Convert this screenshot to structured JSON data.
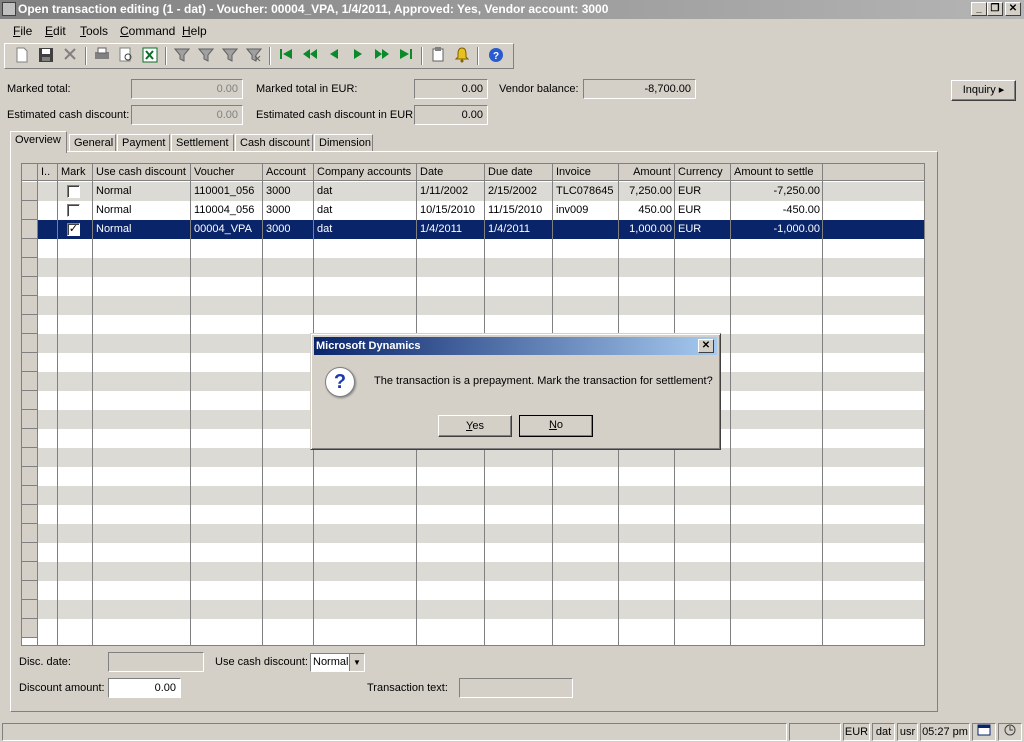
{
  "window": {
    "title": "Open transaction editing (1 - dat) - Voucher: 00004_VPA, 1/4/2011, Approved: Yes, Vendor account: 3000",
    "minimize": "_",
    "restore": "❐",
    "close": "✕"
  },
  "menu": [
    "File",
    "Edit",
    "Tools",
    "Command",
    "Help"
  ],
  "toolbar": {
    "icons": [
      "new-icon",
      "save-icon",
      "delete-icon",
      "print-icon",
      "print-preview-icon",
      "excel-icon",
      "filter-icon",
      "filter-by-selection-icon",
      "advanced-filter-icon",
      "remove-filter-icon",
      "first-record-icon",
      "previous-page-icon",
      "previous-record-icon",
      "next-record-icon",
      "next-page-icon",
      "last-record-icon",
      "document-handling-icon",
      "alert-icon",
      "help-icon"
    ]
  },
  "summary": {
    "marked_total_label": "Marked total:",
    "marked_total_value": "0.00",
    "est_cash_disc_label": "Estimated cash discount:",
    "est_cash_disc_value": "0.00",
    "marked_total_eur_label": "Marked total in EUR:",
    "marked_total_eur_value": "0.00",
    "est_cash_disc_eur_label": "Estimated cash discount in EUR:",
    "est_cash_disc_eur_value": "0.00",
    "vendor_balance_label": "Vendor balance:",
    "vendor_balance_value": "-8,700.00",
    "inquiry_label": "Inquiry"
  },
  "tabs": [
    "Overview",
    "General",
    "Payment",
    "Settlement",
    "Cash discount",
    "Dimension"
  ],
  "grid": {
    "columns": [
      "I..",
      "Mark",
      "Use cash discount",
      "Voucher",
      "Account",
      "Company accounts",
      "Date",
      "Due date",
      "Invoice",
      "Amount",
      "Currency",
      "Amount to settle"
    ],
    "rows": [
      {
        "mark": false,
        "use_cash_discount": "Normal",
        "voucher": "110001_056",
        "account": "3000",
        "company": "dat",
        "date": "1/11/2002",
        "due_date": "2/15/2002",
        "invoice": "TLC078645",
        "amount": "7,250.00",
        "currency": "EUR",
        "amount_to_settle": "-7,250.00"
      },
      {
        "mark": false,
        "use_cash_discount": "Normal",
        "voucher": "110004_056",
        "account": "3000",
        "company": "dat",
        "date": "10/15/2010",
        "due_date": "11/15/2010",
        "invoice": "inv009",
        "amount": "450.00",
        "currency": "EUR",
        "amount_to_settle": "-450.00"
      },
      {
        "mark": true,
        "use_cash_discount": "Normal",
        "voucher": "00004_VPA",
        "account": "3000",
        "company": "dat",
        "date": "1/4/2011",
        "due_date": "1/4/2011",
        "invoice": "",
        "amount": "1,000.00",
        "currency": "EUR",
        "amount_to_settle": "-1,000.00"
      }
    ],
    "check_mark": "✓"
  },
  "bottom": {
    "disc_date_label": "Disc. date:",
    "disc_date_value": "",
    "use_cash_discount_label": "Use cash discount:",
    "use_cash_discount_value": "Normal",
    "discount_amount_label": "Discount amount:",
    "discount_amount_value": "0.00",
    "transaction_text_label": "Transaction text:",
    "transaction_text_value": ""
  },
  "dialog": {
    "title": "Microsoft Dynamics",
    "message": "The transaction is a prepayment. Mark the transaction for settlement?",
    "yes": "Yes",
    "no": "No",
    "icon_glyph": "?",
    "close": "✕"
  },
  "statusbar": {
    "currency": "EUR",
    "company": "dat",
    "user": "usr",
    "time": "05:27 pm"
  }
}
